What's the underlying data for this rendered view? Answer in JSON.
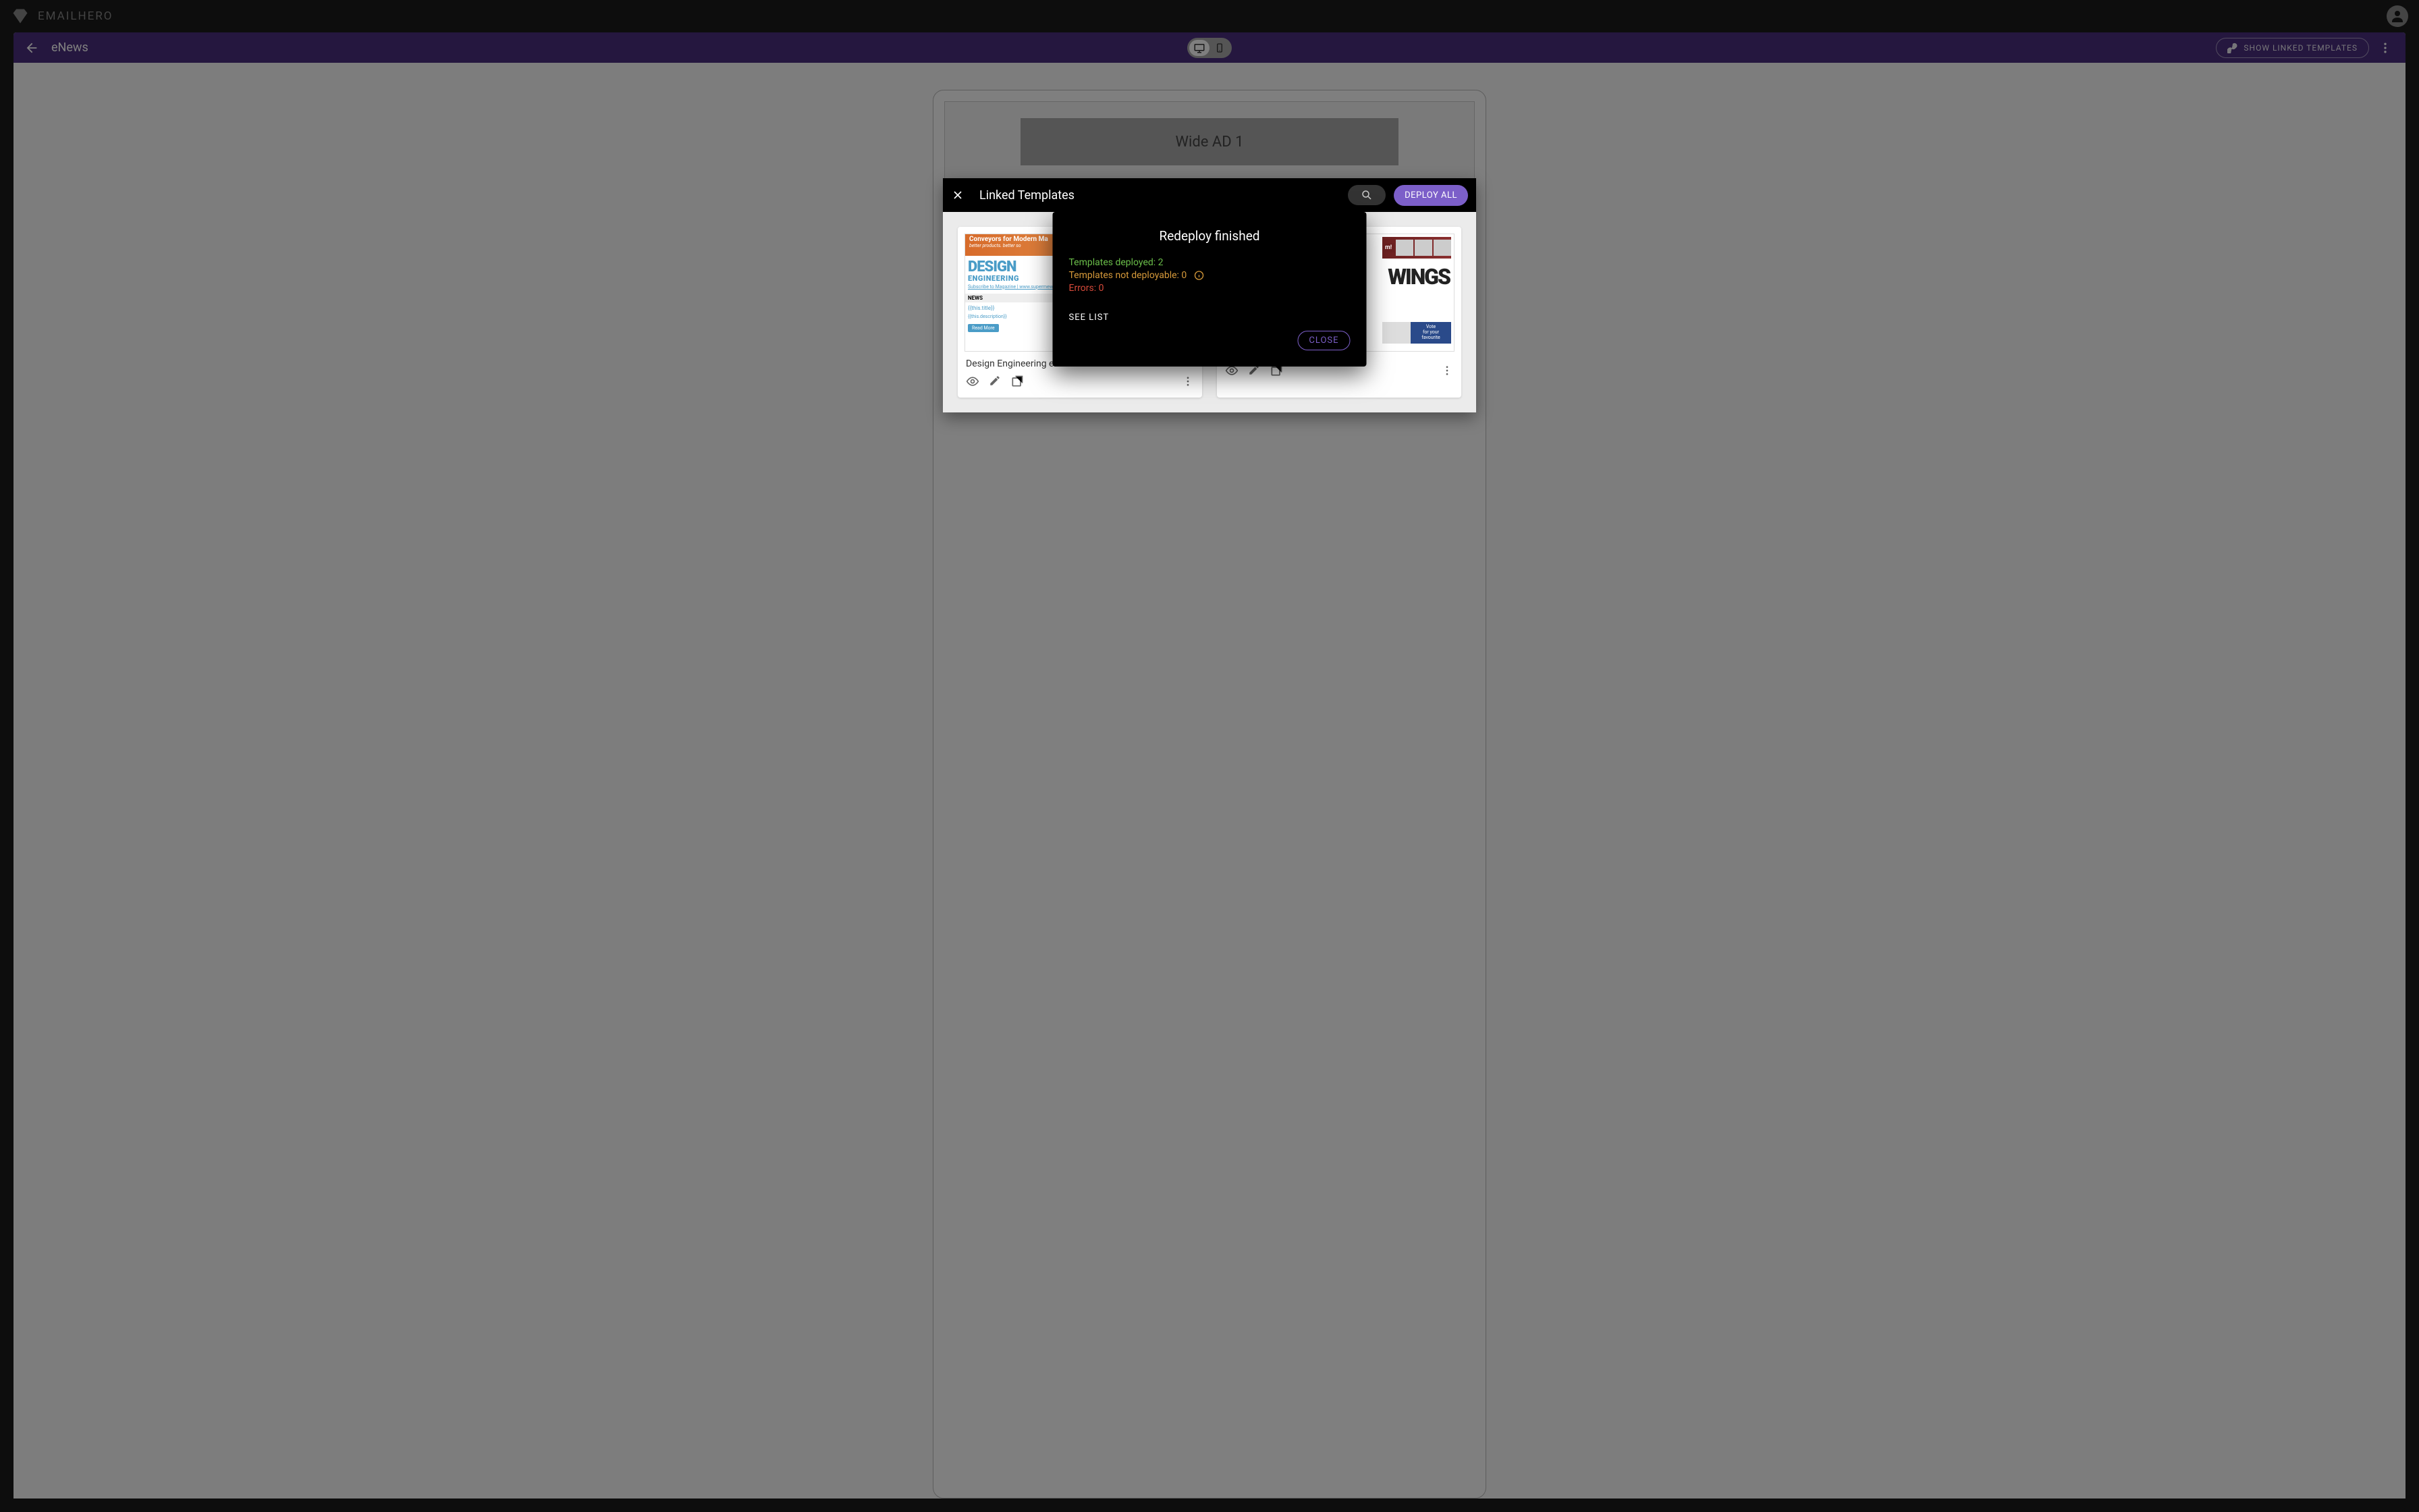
{
  "brand": {
    "name": "EMAILHERO"
  },
  "page": {
    "title": "eNews",
    "show_linked_label": "SHOW LINKED TEMPLATES",
    "ad_label": "Wide AD 1"
  },
  "linked_templates_modal": {
    "title": "Linked Templates",
    "deploy_all_label": "DEPLOY ALL",
    "cards": [
      {
        "name": "Design Engineering eNews",
        "thumb": {
          "banner_title": "Conveyors for Modern Ma",
          "banner_sub": "better products. better so",
          "logo_top": "DESIGN",
          "logo_bottom": "ENGINEERING",
          "link_text": "Subscribe to Magazine | www.supermewsstore.com",
          "news_label": "NEWS",
          "title_ph": "{{this.title}}",
          "desc_ph": "{{this.description}}",
          "tag": "Read More"
        }
      },
      {
        "name": "",
        "thumb": {
          "header_label": "m!",
          "wings": "WINGS",
          "vote_line1": "Vote",
          "vote_line2": "for your",
          "vote_line3": "favourite"
        }
      }
    ]
  },
  "redeploy_modal": {
    "title": "Redeploy finished",
    "deployed_label": "Templates deployed: 2",
    "not_deployable_label": "Templates not deployable: 0",
    "errors_label": "Errors: 0",
    "see_list_label": "SEE LIST",
    "close_label": "CLOSE"
  }
}
